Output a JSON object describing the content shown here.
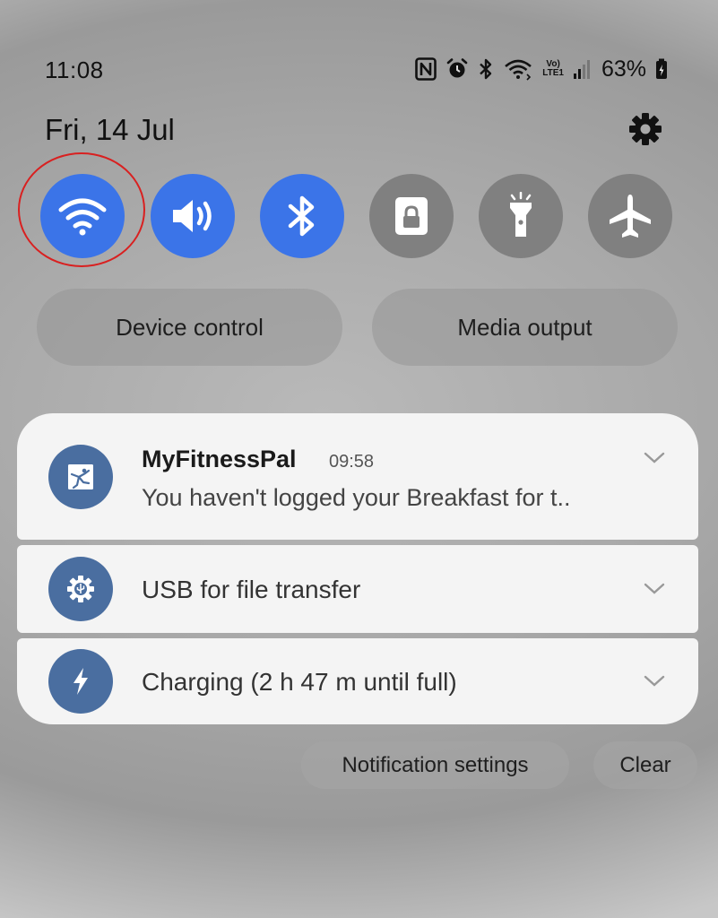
{
  "status_bar": {
    "time": "11:08",
    "battery_percent": "63%",
    "network_label_top": "Vo)",
    "network_label_bottom": "LTE1",
    "icons": [
      "nfc-icon",
      "alarm-icon",
      "bluetooth-icon",
      "wifi-icon",
      "volte-icon",
      "signal-icon",
      "battery-charging-icon"
    ]
  },
  "header": {
    "date": "Fri, 14 Jul",
    "settings_icon": "gear-icon"
  },
  "quick_settings": [
    {
      "name": "wifi",
      "icon": "wifi-icon",
      "state": "on"
    },
    {
      "name": "sound",
      "icon": "speaker-icon",
      "state": "on"
    },
    {
      "name": "bluetooth",
      "icon": "bluetooth-icon",
      "state": "on"
    },
    {
      "name": "lock-screen",
      "icon": "lock-icon",
      "state": "off"
    },
    {
      "name": "flashlight",
      "icon": "flashlight-icon",
      "state": "off"
    },
    {
      "name": "airplane-mode",
      "icon": "airplane-icon",
      "state": "off"
    }
  ],
  "colors": {
    "accent_on": "#3b74e8",
    "tile_off": "#808080",
    "highlight_ring": "#d92020",
    "app_icon_bg": "#4a6ea0"
  },
  "shortcuts": {
    "device_control": "Device control",
    "media_output": "Media output"
  },
  "notifications": [
    {
      "app": "MyFitnessPal",
      "time": "09:58",
      "text": "You haven't logged your Breakfast for t..",
      "icon": "myfitnesspal-icon"
    },
    {
      "text": "USB for file transfer",
      "icon": "usb-settings-icon"
    },
    {
      "text": "Charging (2 h 47 m until full)",
      "icon": "charging-bolt-icon"
    }
  ],
  "actions": {
    "notification_settings": "Notification settings",
    "clear": "Clear"
  }
}
